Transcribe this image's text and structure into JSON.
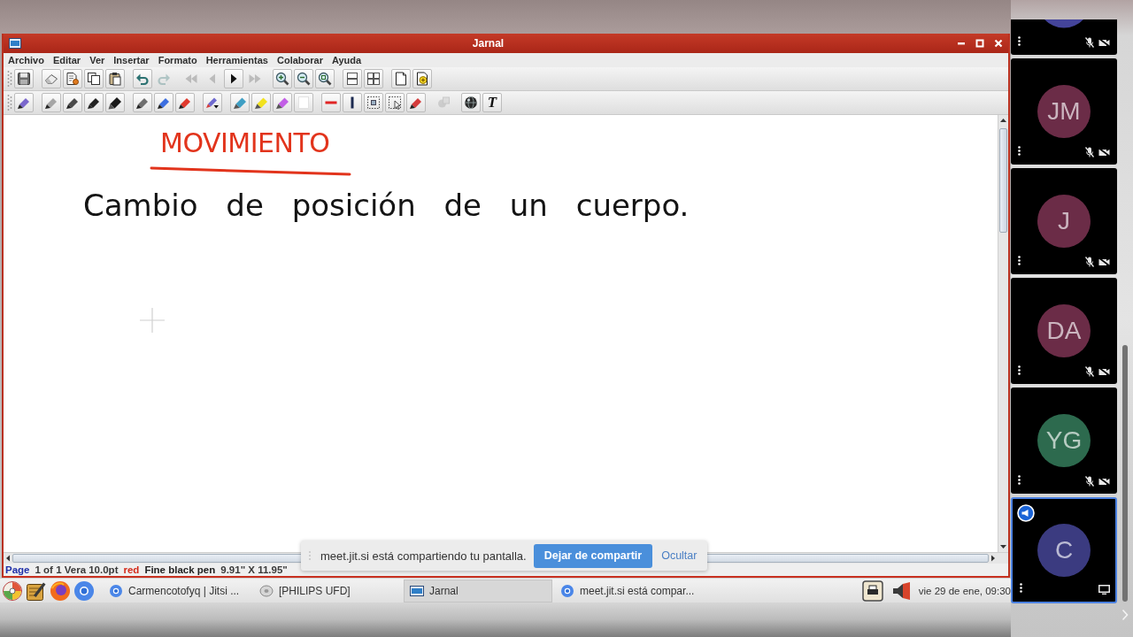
{
  "window": {
    "title": "Jarnal"
  },
  "menu": [
    "Archivo",
    "Editar",
    "Ver",
    "Insertar",
    "Formato",
    "Herramientas",
    "Colaborar",
    "Ayuda"
  ],
  "toolbars": [
    {
      "groups": [
        {
          "buttons": [
            {
              "kind": "save",
              "disabled": false
            }
          ]
        },
        {
          "buttons": [
            {
              "kind": "erase",
              "disabled": false
            },
            {
              "kind": "cut",
              "disabled": false
            },
            {
              "kind": "copy",
              "disabled": false
            },
            {
              "kind": "paste",
              "disabled": false
            }
          ]
        },
        {
          "buttons": [
            {
              "kind": "undo",
              "disabled": false
            },
            {
              "kind": "redo",
              "disabled": true
            }
          ]
        },
        {
          "buttons": [
            {
              "kind": "first",
              "disabled": true
            },
            {
              "kind": "prev",
              "disabled": true
            },
            {
              "kind": "next",
              "disabled": false
            },
            {
              "kind": "last",
              "disabled": true
            }
          ]
        },
        {
          "buttons": [
            {
              "kind": "zoomin",
              "disabled": false
            },
            {
              "kind": "zoomout",
              "disabled": false
            },
            {
              "kind": "zoomfit",
              "disabled": false
            }
          ]
        },
        {
          "buttons": [
            {
              "kind": "rows",
              "disabled": false
            },
            {
              "kind": "grid",
              "disabled": false
            }
          ]
        },
        {
          "buttons": [
            {
              "kind": "page",
              "disabled": false
            },
            {
              "kind": "addpage",
              "disabled": false
            }
          ]
        }
      ]
    },
    {
      "groups": [
        {
          "buttons": [
            {
              "kind": "pen",
              "color": "#7a66cc",
              "disabled": false
            }
          ]
        },
        {
          "buttons": [
            {
              "kind": "pen",
              "color": "#a6a6a6",
              "disabled": false
            },
            {
              "kind": "pen",
              "color": "#4a4a4a",
              "disabled": false
            },
            {
              "kind": "pen",
              "color": "#222222",
              "disabled": false
            },
            {
              "kind": "marker",
              "color": "#1a1a1a",
              "disabled": false
            }
          ]
        },
        {
          "buttons": [
            {
              "kind": "pen",
              "color": "#6e6e6e",
              "disabled": false
            },
            {
              "kind": "pen",
              "color": "#3c6ee0",
              "disabled": false
            },
            {
              "kind": "pen",
              "color": "#e03a2e",
              "disabled": false
            }
          ]
        },
        {
          "buttons": [
            {
              "kind": "penmenu",
              "disabled": false
            }
          ]
        },
        {
          "buttons": [
            {
              "kind": "highlighter",
              "color": "#3f9fc4",
              "disabled": false
            },
            {
              "kind": "highlighter",
              "color": "#f2e21e",
              "disabled": false
            },
            {
              "kind": "highlighter",
              "color": "#c25ee6",
              "disabled": false
            },
            {
              "kind": "blank",
              "disabled": false
            }
          ]
        },
        {
          "buttons": [
            {
              "kind": "dash",
              "disabled": false
            },
            {
              "kind": "bar",
              "disabled": false
            },
            {
              "kind": "select",
              "disabled": false
            },
            {
              "kind": "selectarrow",
              "disabled": false
            },
            {
              "kind": "pen",
              "color": "#d43c3c",
              "disabled": false
            }
          ]
        },
        {
          "buttons": [
            {
              "kind": "stamp",
              "disabled": true
            }
          ]
        },
        {
          "buttons": [
            {
              "kind": "globe",
              "disabled": false
            },
            {
              "kind": "text",
              "label": "T",
              "disabled": false
            }
          ]
        }
      ]
    }
  ],
  "canvas": {
    "ink": [
      {
        "kind": "heading",
        "text": "MOVIMIENTO",
        "color": "#e2341c",
        "underlined": true
      },
      {
        "kind": "body",
        "text": "Cambio de posición de un cuerpo.",
        "color": "#141414",
        "underlined": false
      }
    ]
  },
  "status_bar": {
    "segments": [
      {
        "text": "Page",
        "color": "#1f2fa8"
      },
      {
        "text": "1 of 1 Vera 10.0pt",
        "color": "#3a3a3a"
      },
      {
        "text": "red",
        "color": "#d42a1a"
      },
      {
        "text": "Fine black pen",
        "color": "#222222"
      },
      {
        "text": "9.91\" X 11.95\"",
        "color": "#3a3a3a"
      }
    ]
  },
  "notification": {
    "message": "meet.jit.si está compartiendo tu pantalla.",
    "buttons": [
      {
        "kind": "primary",
        "label": "Dejar de compartir"
      },
      {
        "kind": "link",
        "label": "Ocultar"
      }
    ]
  },
  "taskbar": {
    "launchers": [
      {
        "kind": "pinwheel"
      },
      {
        "kind": "notepad"
      },
      {
        "kind": "swirl"
      },
      {
        "kind": "ring"
      }
    ],
    "tasks": [
      {
        "kind": "browser",
        "label": "Carmencotofyq | Jitsi ...",
        "selected": false
      },
      {
        "kind": "drive",
        "label": "[PHILIPS UFD]",
        "selected": false
      },
      {
        "kind": "app",
        "label": "Jarnal",
        "selected": true
      },
      {
        "kind": "browser",
        "label": "meet.jit.si está compar...",
        "selected": false
      }
    ],
    "tray": [
      {
        "kind": "printer"
      },
      {
        "kind": "speaker"
      }
    ],
    "clock": "vie 29 de ene, 09:30"
  },
  "participants": [
    {
      "kind": "partial",
      "color": "#44449a",
      "mic_muted": true,
      "camera_off": true,
      "screen_sharing": false,
      "speaking": false
    },
    {
      "kind": "full",
      "initials": "JM",
      "color": "#6b2c47",
      "mic_muted": true,
      "camera_off": true,
      "screen_sharing": false,
      "speaking": false
    },
    {
      "kind": "full",
      "initials": "J",
      "color": "#6b2c47",
      "mic_muted": true,
      "camera_off": true,
      "screen_sharing": false,
      "speaking": false
    },
    {
      "kind": "full",
      "initials": "DA",
      "color": "#6b2c47",
      "mic_muted": true,
      "camera_off": true,
      "screen_sharing": false,
      "speaking": false
    },
    {
      "kind": "full",
      "initials": "YG",
      "color": "#2d6a4e",
      "mic_muted": true,
      "camera_off": true,
      "screen_sharing": false,
      "speaking": false
    },
    {
      "kind": "full",
      "initials": "C",
      "color": "#3b3b80",
      "mic_muted": false,
      "camera_off": false,
      "screen_sharing": true,
      "speaking": true
    }
  ]
}
